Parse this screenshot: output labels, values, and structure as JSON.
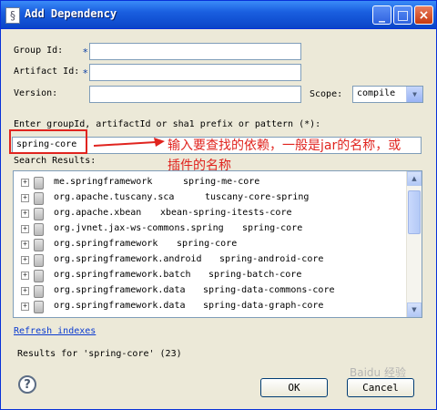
{
  "window": {
    "title": "Add Dependency",
    "minimize": "_",
    "maximize": "□",
    "close": "×"
  },
  "form": {
    "group_id_label": "Group Id:",
    "artifact_id_label": "Artifact Id:",
    "version_label": "Version:",
    "required_marker": "*",
    "scope_label": "Scope:",
    "scope_value": "compile",
    "group_id_value": "",
    "artifact_id_value": "",
    "version_value": ""
  },
  "search": {
    "label": "Enter groupId, artifactId or sha1 prefix or pattern (*):",
    "value": "spring-core",
    "results_label": "Search Results:"
  },
  "annotation": {
    "line1": "输入要查找的依赖，一般是jar的名称，或",
    "line2": "插件的名称",
    "color": "#e0241f"
  },
  "results": [
    {
      "group": "me.springframework",
      "artifact": "spring-me-core"
    },
    {
      "group": "org.apache.tuscany.sca",
      "artifact": "tuscany-core-spring"
    },
    {
      "group": "org.apache.xbean",
      "artifact": "xbean-spring-itests-core"
    },
    {
      "group": "org.jvnet.jax-ws-commons.spring",
      "artifact": "spring-core"
    },
    {
      "group": "org.springframework",
      "artifact": "spring-core"
    },
    {
      "group": "org.springframework.android",
      "artifact": "spring-android-core"
    },
    {
      "group": "org.springframework.batch",
      "artifact": "spring-batch-core"
    },
    {
      "group": "org.springframework.data",
      "artifact": "spring-data-commons-core"
    },
    {
      "group": "org.springframework.data",
      "artifact": "spring-data-graph-core"
    }
  ],
  "footer": {
    "refresh_link": "Refresh indexes",
    "results_summary": "Results for 'spring-core' (23)",
    "ok_label": "OK",
    "cancel_label": "Cancel",
    "help_glyph": "?",
    "watermark": "Baidu 经验"
  },
  "icons": [
    "title-document-icon",
    "minimize-icon",
    "maximize-icon",
    "close-icon",
    "expand-plus-icon",
    "jar-icon",
    "help-icon",
    "arrow-annotation"
  ]
}
